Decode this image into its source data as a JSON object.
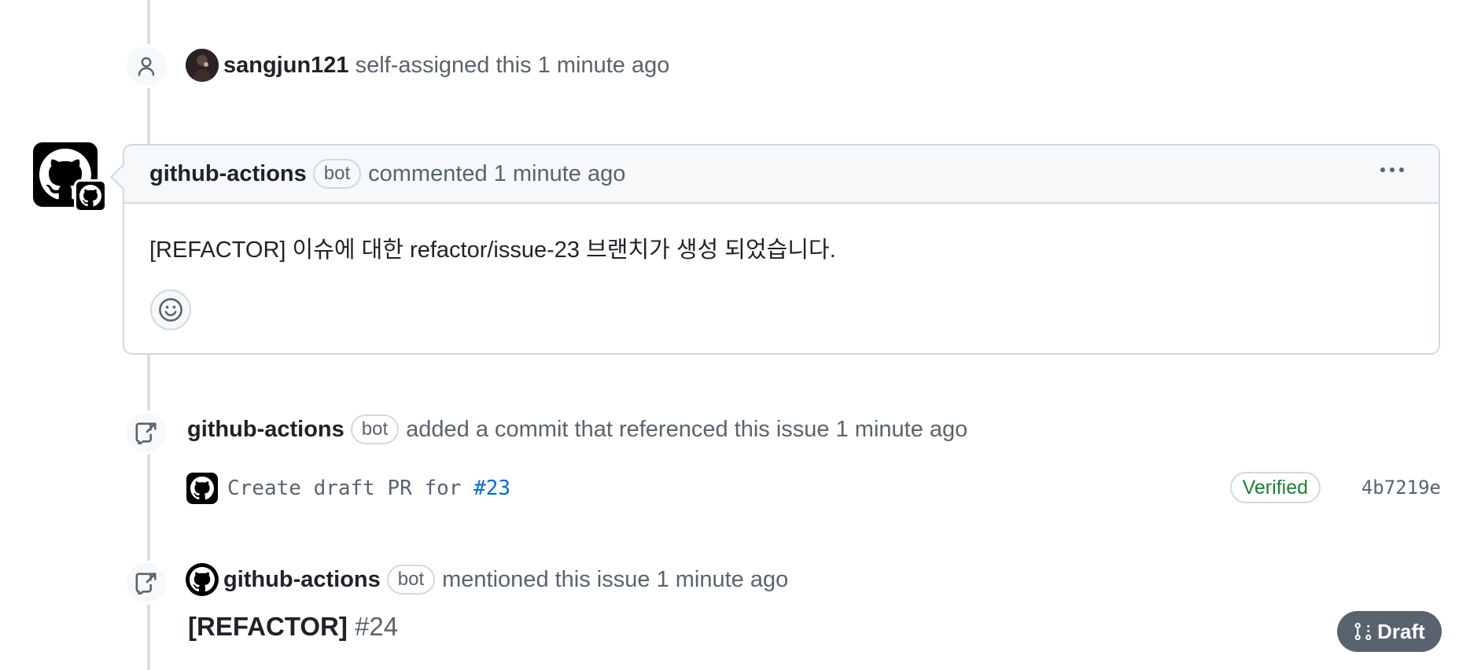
{
  "events": {
    "assigned": {
      "actor": "sangjun121",
      "text": "self-assigned this 1 minute ago",
      "icon": "person-icon"
    },
    "comment": {
      "actor": "github-actions",
      "badge": "bot",
      "action": "commented 1 minute ago",
      "body": "[REFACTOR] 이슈에 대한 refactor/issue-23 브랜치가 생성 되었습니다.",
      "menu_icon": "kebab-horizontal-icon",
      "reaction_icon": "smiley-icon"
    },
    "commit_ref": {
      "actor": "github-actions",
      "badge": "bot",
      "text": "added a commit that referenced this issue 1 minute ago",
      "icon": "cross-reference-icon",
      "commit": {
        "message": "Create draft PR for",
        "issue_link": "#23",
        "verified": "Verified",
        "sha": "4b7219e"
      }
    },
    "mention": {
      "actor": "github-actions",
      "badge": "bot",
      "text": "mentioned this issue 1 minute ago",
      "icon": "cross-reference-icon",
      "ref": {
        "title": "[REFACTOR]",
        "number": "#24",
        "state": "Draft",
        "state_icon": "git-pull-request-draft-icon"
      }
    }
  },
  "colors": {
    "accent_link": "#0969da",
    "verified_green": "#1a7f37",
    "draft_gray": "#59636e",
    "border": "#d1d9e0",
    "muted_bg": "#f6f8fa"
  }
}
